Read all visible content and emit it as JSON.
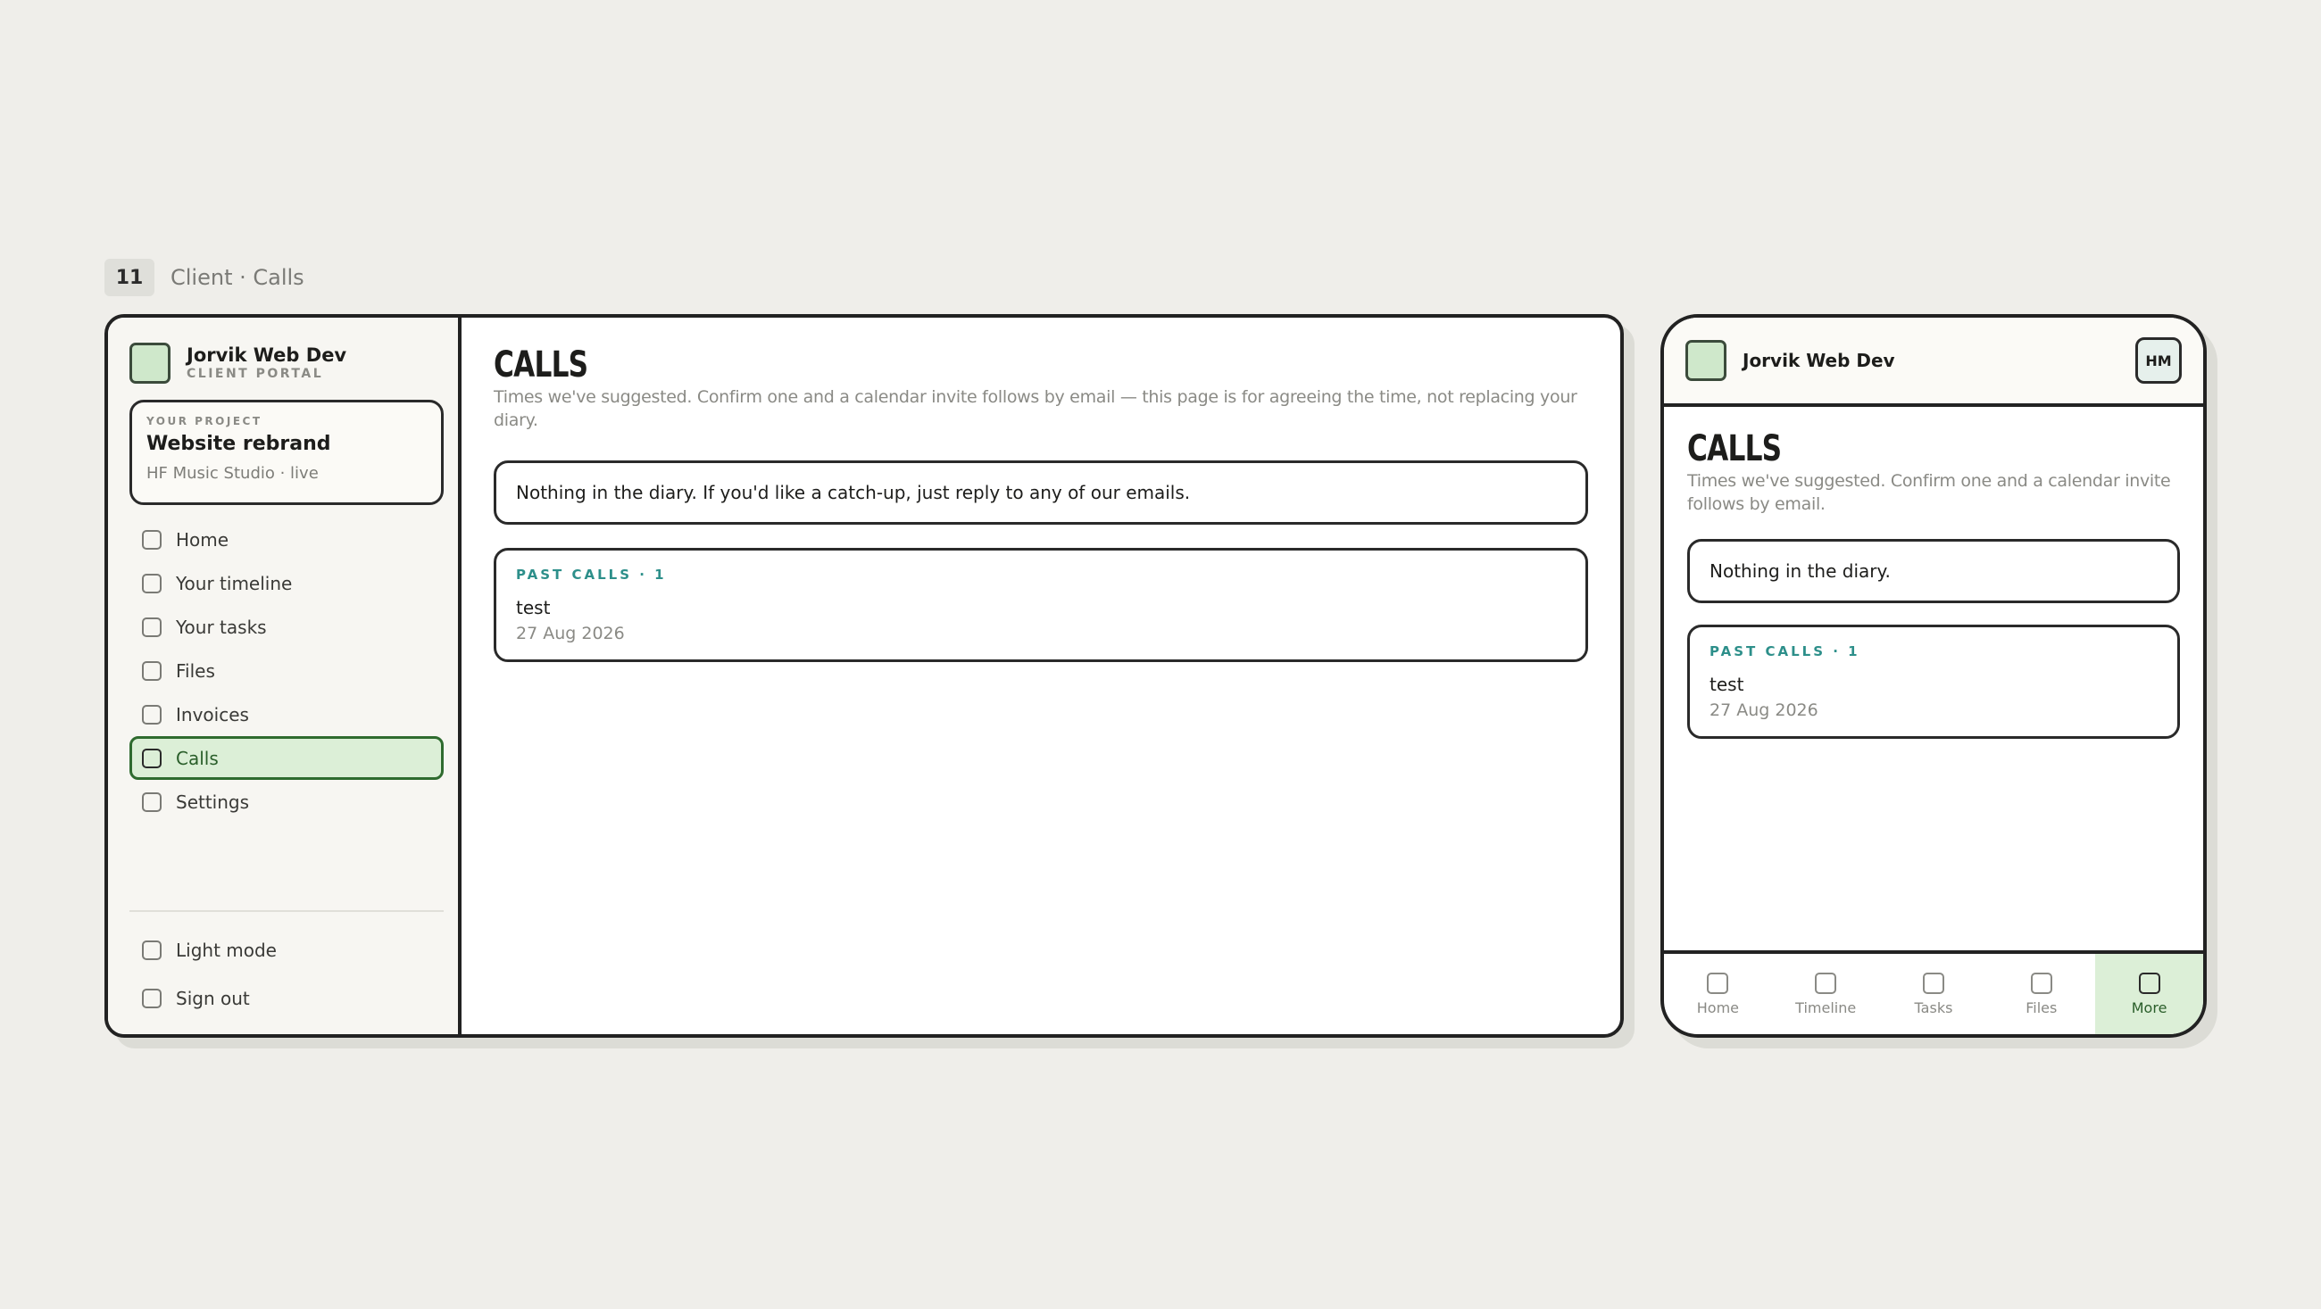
{
  "screen_label": {
    "number": "11",
    "text": "Client · Calls"
  },
  "brand": {
    "name": "Jorvik Web Dev",
    "subtitle": "CLIENT PORTAL",
    "avatar_initials": "HM"
  },
  "project": {
    "kicker": "YOUR PROJECT",
    "name": "Website rebrand",
    "meta": "HF Music Studio · live"
  },
  "nav": {
    "items": [
      {
        "label": "Home",
        "icon": "checkbox-icon",
        "active": false
      },
      {
        "label": "Your timeline",
        "icon": "checkbox-icon",
        "active": false
      },
      {
        "label": "Your tasks",
        "icon": "checkbox-icon",
        "active": false
      },
      {
        "label": "Files",
        "icon": "checkbox-icon",
        "active": false
      },
      {
        "label": "Invoices",
        "icon": "checkbox-icon",
        "active": false
      },
      {
        "label": "Calls",
        "icon": "checkbox-icon",
        "active": true
      },
      {
        "label": "Settings",
        "icon": "checkbox-icon",
        "active": false
      }
    ],
    "bottom": [
      {
        "label": "Light mode",
        "icon": "checkbox-icon"
      },
      {
        "label": "Sign out",
        "icon": "checkbox-icon"
      }
    ]
  },
  "page": {
    "title": "CALLS",
    "subtitle_desktop": "Times we've suggested. Confirm one and a calendar invite follows by email — this page is for agreeing the time, not replacing your diary.",
    "subtitle_mobile": "Times we've suggested. Confirm one and a calendar invite follows by email.",
    "empty_desktop": "Nothing in the diary. If you'd like a catch-up, just reply to any of our emails.",
    "empty_mobile": "Nothing in the diary.",
    "past": {
      "kicker": "PAST CALLS · 1",
      "items": [
        {
          "name": "test",
          "date": "27 Aug 2026"
        }
      ]
    }
  },
  "tabbar": {
    "items": [
      {
        "label": "Home",
        "active": false
      },
      {
        "label": "Timeline",
        "active": false
      },
      {
        "label": "Tasks",
        "active": false
      },
      {
        "label": "Files",
        "active": false
      },
      {
        "label": "More",
        "active": true
      }
    ]
  },
  "colors": {
    "accent_green": "#dcefd7",
    "accent_teal": "#2d8f8a",
    "background": "#efeeea"
  }
}
